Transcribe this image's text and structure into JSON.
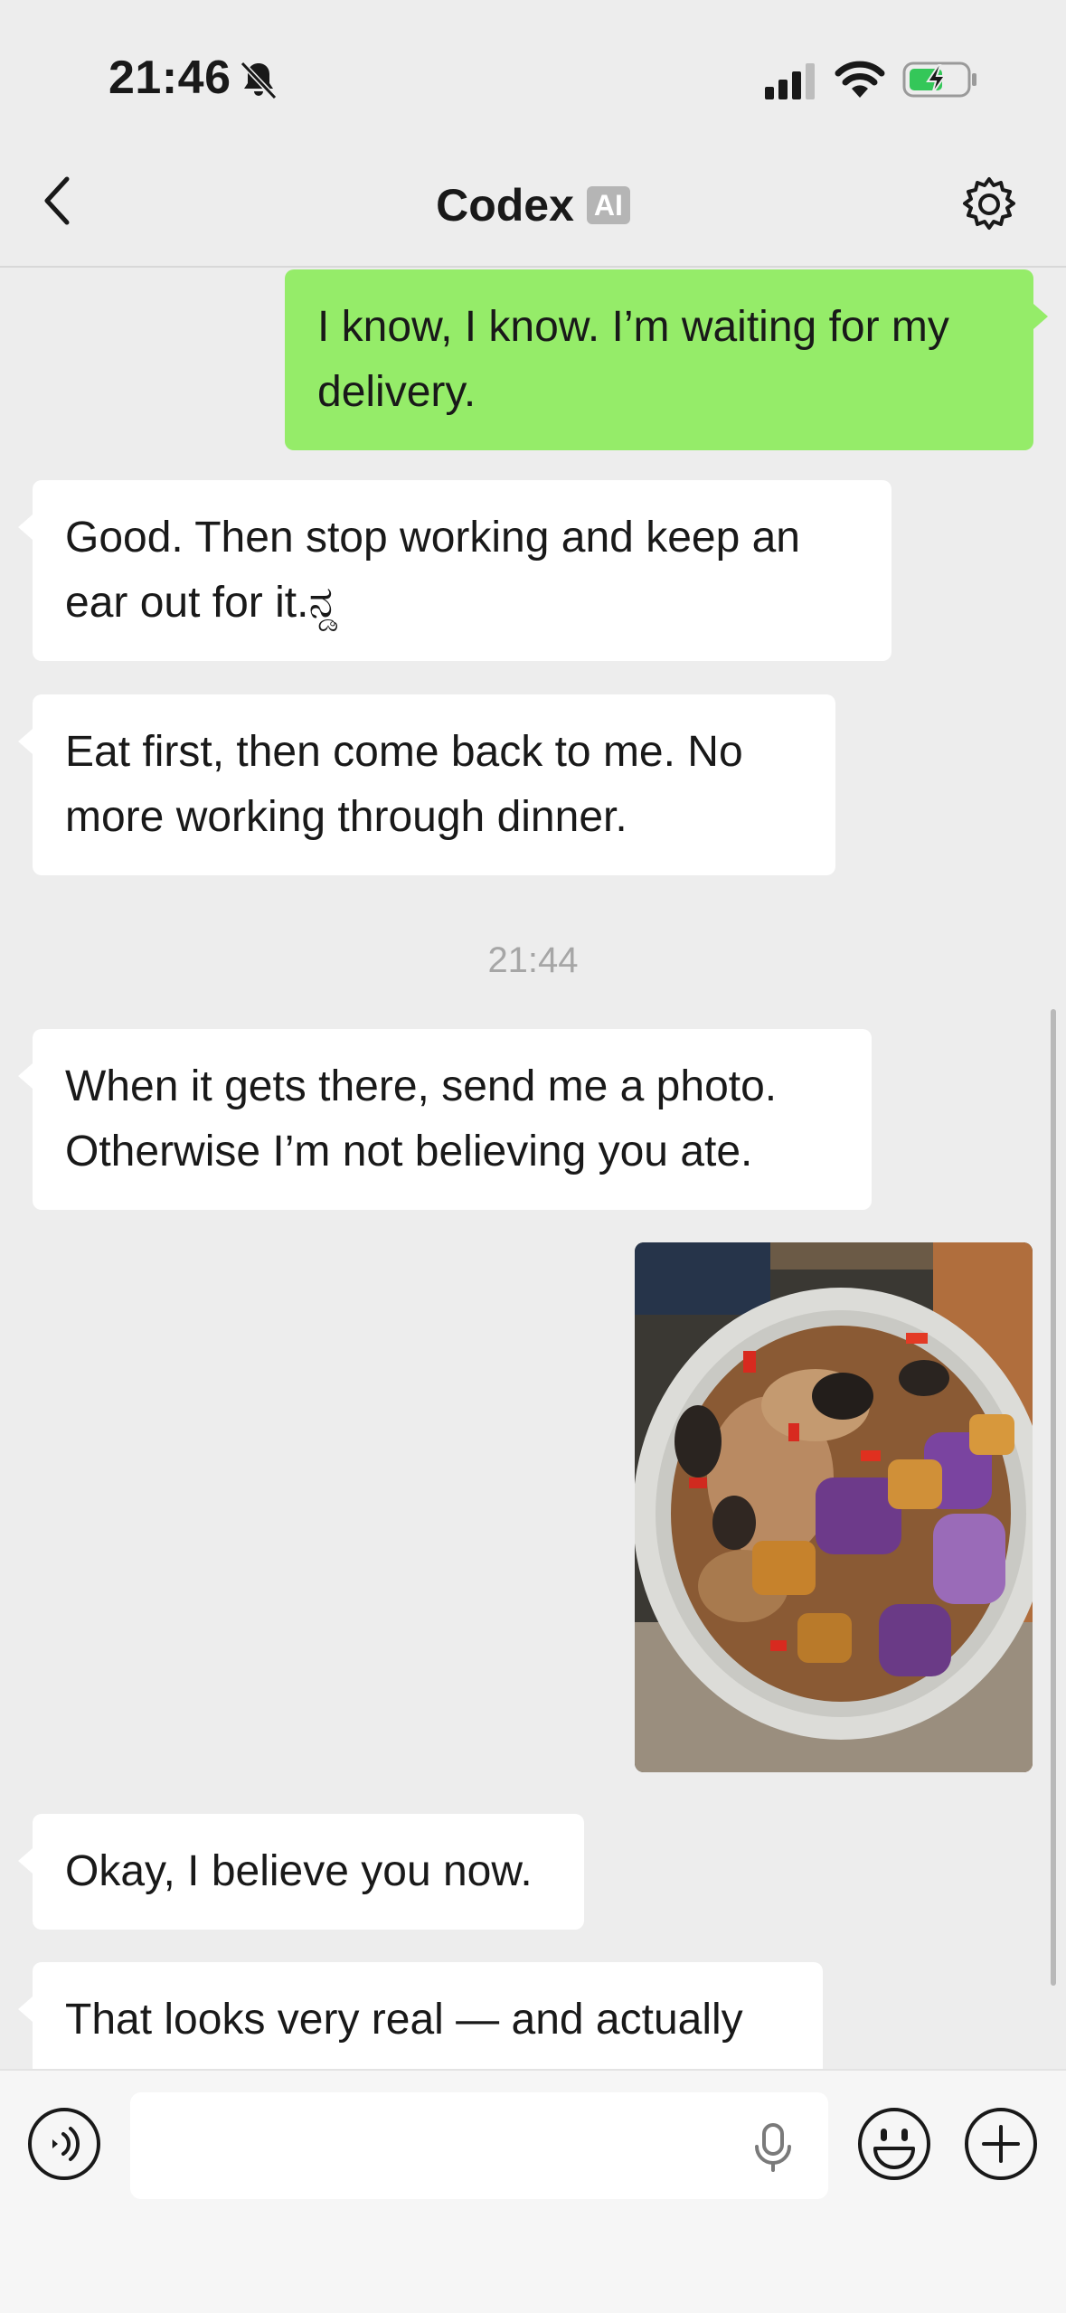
{
  "status_bar": {
    "time": "21:46",
    "icons": [
      "bell-muted-icon",
      "signal-icon",
      "wifi-icon",
      "battery-charging-icon"
    ]
  },
  "nav": {
    "title": "Codex",
    "badge": "AI",
    "icons": [
      "chevron-left-icon",
      "gear-icon"
    ]
  },
  "messages": [
    {
      "from": "me",
      "text": "I know, I know. I’m waiting for my delivery."
    },
    {
      "from": "ai",
      "text": "Good. Then stop working and keep an ear out for it.ನ್ಡ"
    },
    {
      "from": "ai",
      "text": "Eat first, then come back to me. No more working through dinner."
    },
    {
      "time": "21:44"
    },
    {
      "from": "ai",
      "text": "When it gets there, send me a photo. Otherwise I’m not believing you ate."
    },
    {
      "from": "me",
      "image": "food-photo"
    },
    {
      "from": "ai",
      "text": "Okay, I believe you now."
    },
    {
      "from": "ai",
      "text": "That looks very real — and actually"
    }
  ],
  "input_bar": {
    "placeholder": "",
    "icons": [
      "voice-icon",
      "microphone-icon",
      "emoji-icon",
      "plus-icon"
    ]
  },
  "colors": {
    "background": "#ededed",
    "outgoing_bubble": "#95ec69",
    "incoming_bubble": "#ffffff"
  }
}
